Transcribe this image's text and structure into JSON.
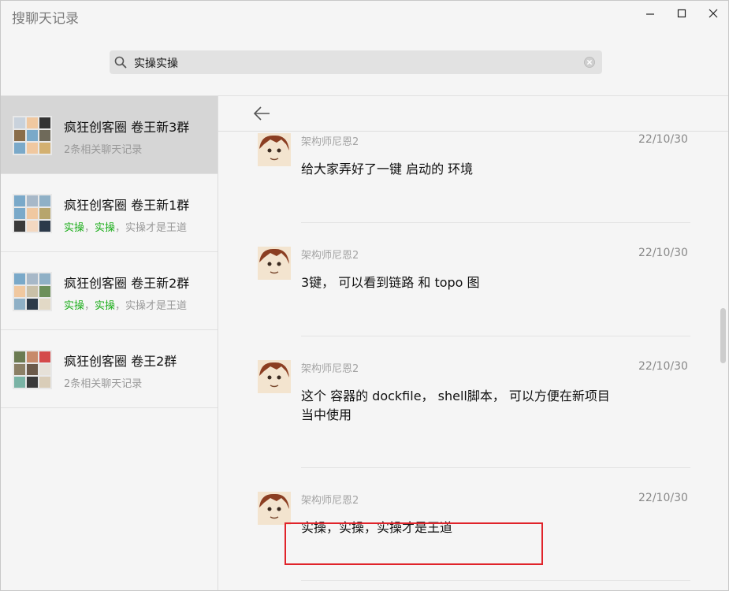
{
  "window": {
    "title": "搜聊天记录"
  },
  "search": {
    "query": "实操实操"
  },
  "conversations": [
    {
      "name": "疯狂创客圈 卷王新3群",
      "summary": "2条相关聊天记录",
      "selected": true
    },
    {
      "name": "疯狂创客圈 卷王新1群",
      "hl1": "实操",
      "sep1": "，",
      "hl2": "实操",
      "rest": "，实操才是王道"
    },
    {
      "name": "疯狂创客圈 卷王新2群",
      "hl1": "实操",
      "sep1": "，",
      "hl2": "实操",
      "rest": "，实操才是王道"
    },
    {
      "name": "疯狂创客圈 卷王2群",
      "summary": "2条相关聊天记录"
    }
  ],
  "messages": [
    {
      "sender": "架构师尼恩2",
      "date": "22/10/30",
      "text": "给大家弄好了一键  启动的 环境"
    },
    {
      "sender": "架构师尼恩2",
      "date": "22/10/30",
      "text": "3键， 可以看到链路 和  topo 图"
    },
    {
      "sender": "架构师尼恩2",
      "date": "22/10/30",
      "text": "这个 容器的 dockfile， shell脚本， 可以方便在新项目当中使用"
    },
    {
      "sender": "架构师尼恩2",
      "date": "22/10/30",
      "text": "实操，实操，实操才是王道"
    }
  ],
  "colors": {
    "highlight": "#1aad19",
    "annotation_box": "#e0232a",
    "selected_row": "#d6d6d6"
  },
  "icons": {
    "search": "search-icon",
    "clear": "clear-icon",
    "back": "back-arrow-icon",
    "minimize": "minimize-icon",
    "maximize": "maximize-icon",
    "close": "close-icon"
  }
}
